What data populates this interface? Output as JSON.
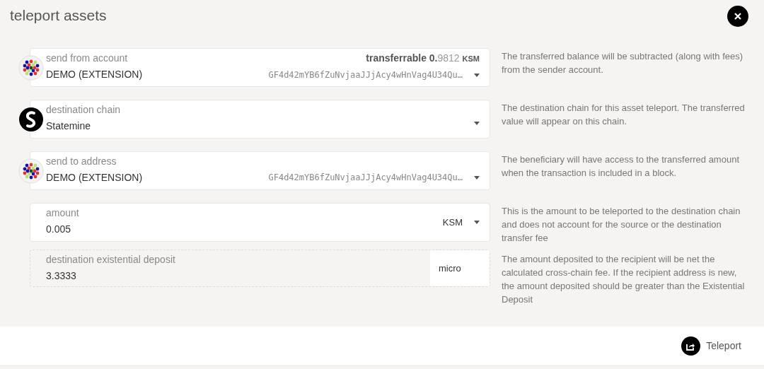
{
  "title": "teleport assets",
  "rows": [
    {
      "kind": "account",
      "label": "send from account",
      "value": "DEMO (EXTENSION)",
      "address": "GF4d42mYB6fZuNvjaaJJjAcy4wHnVag4U34Qu…",
      "balance": {
        "label": "transferrable",
        "whole": "0.",
        "decimals": "9812",
        "unit": "KSM"
      },
      "help": "The transferred balance will be subtracted (along with fees) from the sender account."
    },
    {
      "kind": "chain",
      "label": "destination chain",
      "value": "Statemine",
      "help": "The destination chain for this asset teleport. The transferred value will appear on this chain."
    },
    {
      "kind": "account",
      "label": "send to address",
      "value": "DEMO (EXTENSION)",
      "address": "GF4d42mYB6fZuNvjaaJJjAcy4wHnVag4U34Qu…",
      "help": "The beneficiary will have access to the transferred amount when the transaction is included in a block."
    },
    {
      "kind": "amount",
      "label": "amount",
      "value": "0.005",
      "unit": "KSM",
      "help": "This is the amount to be teleported to the destination chain and does not account for the source or the destination transfer fee"
    },
    {
      "kind": "static",
      "label": "destination existential deposit",
      "value": "3.3333",
      "unit": "micro",
      "help": "The amount deposited to the recipient will be net the calculated cross-chain fee. If the recipient address is new, the amount deposited should be greater than the Existential Deposit"
    }
  ],
  "action": "Teleport"
}
